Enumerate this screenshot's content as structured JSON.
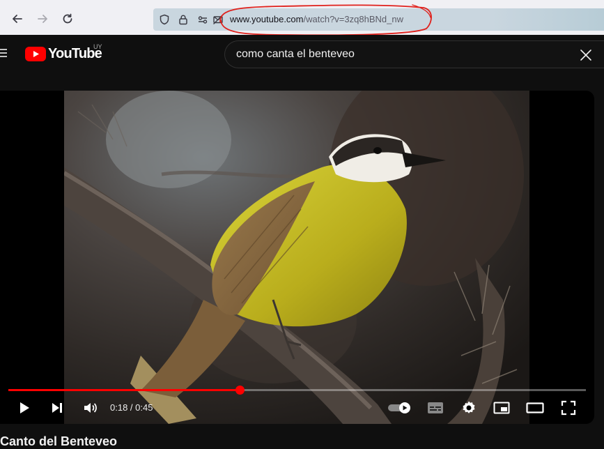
{
  "browser": {
    "url_host": "www.youtube.com",
    "url_path": "/watch?v=3zq8hBNd_nw"
  },
  "header": {
    "logo_text": "YouTube",
    "region": "UY",
    "search_value": "como canta el benteveo"
  },
  "player": {
    "current_time": "0:18",
    "duration": "0:45",
    "time_display": "0:18 / 0:45",
    "progress_fraction": 0.4
  },
  "video": {
    "title": "Canto del Benteveo"
  },
  "colors": {
    "youtube_red": "#ff0000",
    "annotation": "#e0201b"
  }
}
